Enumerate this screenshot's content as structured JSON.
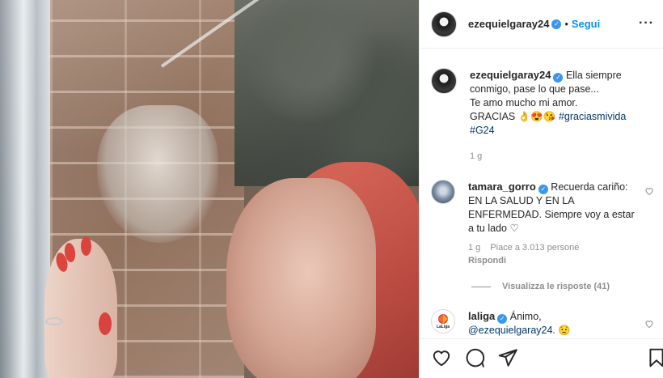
{
  "photo": {
    "alt_subject": ""
  },
  "header": {
    "username": "ezequielgaray24",
    "separator": "•",
    "follow_label": "Segui",
    "more_label": "···"
  },
  "caption": {
    "username": "ezequielgaray24",
    "line1": "Ella siempre",
    "line2": "conmigo, pase lo que pase...",
    "line3": "Te amo mucho mi amor.",
    "line4_text": "GRACIAS ",
    "line4_emojis": "👌😍😘",
    "hashtag1": "#graciasmivida",
    "hashtag2": "#G24",
    "time": "1 g"
  },
  "comments": [
    {
      "username": "tamara_gorro",
      "text": "Recuerda cariño: EN LA SALUD Y EN LA ENFERMEDAD. Siempre voy a estar a tu lado",
      "emoji": "♡",
      "time": "1 g",
      "likes": "Piace a 3.013 persone",
      "reply_label": "Rispondi"
    },
    {
      "username": "laliga",
      "text": "Ánimo,",
      "mention": "@ezequielgaray24.",
      "emoji": "😟",
      "avatar_label": "LaLiga"
    }
  ],
  "view_replies": "Visualizza le risposte (41)",
  "actions": {
    "like_icon": "heart-outline-icon",
    "comment_icon": "comment-bubble-icon",
    "share_icon": "paper-plane-icon",
    "save_icon": "bookmark-icon"
  },
  "colors": {
    "accent": "#0095f6",
    "verified": "#3897f0",
    "meta": "#8e8e8e",
    "hashtag": "#00376b"
  }
}
